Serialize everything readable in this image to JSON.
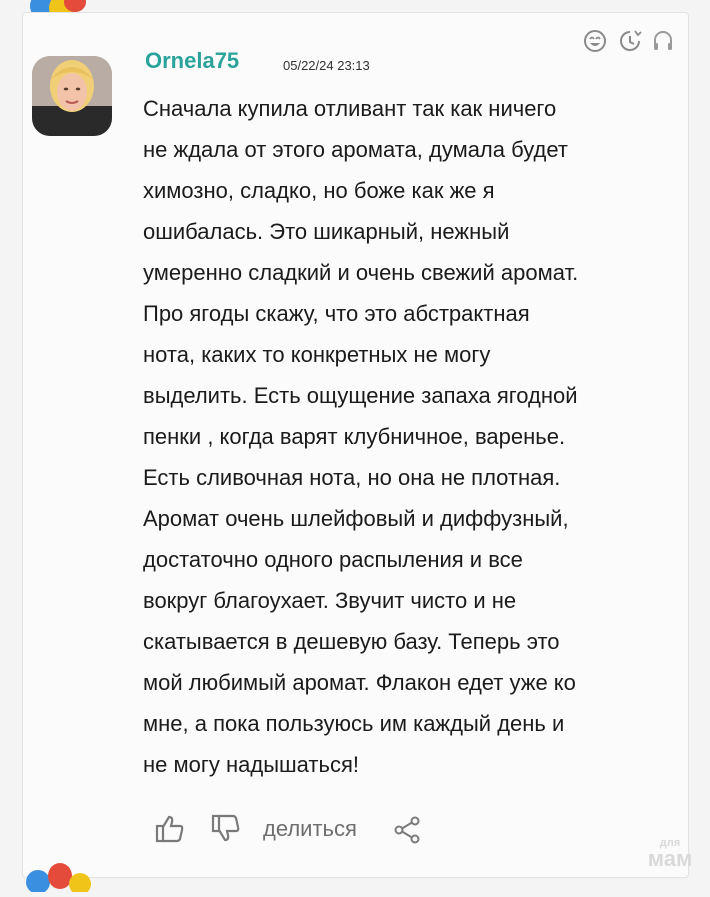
{
  "post": {
    "username": "Ornela75",
    "timestamp": "05/22/24 23:13",
    "lines": [
      "Сначала купила отливант так как ничего",
      "не ждала от этого аромата, думала будет",
      "химозно, сладко, но боже как же я",
      "ошибалась. Это шикарный, нежный",
      "умеренно сладкий и очень свежий аромат.",
      "Про ягоды скажу, что это абстрактная",
      "нота, каких то конкретных не могу",
      "выделить. Есть ощущение запаха ягодной",
      "пенки , когда варят клубничное, варенье.",
      "Есть сливочная нота, но она не плотная.",
      "Аромат очень шлейфовый и диффузный,",
      "достаточно одного распыления и все",
      "вокруг благоухает. Звучит чисто и не",
      "скатывается в дешевую базу. Теперь это",
      "мой любимый аромат. Флакон едет уже ко",
      "мне, а пока пользуюсь им каждый день и",
      "не могу надышаться!"
    ]
  },
  "actions": {
    "share_label": "делиться"
  },
  "watermark": {
    "top": "для",
    "bottom": "мам"
  },
  "icons": [
    "smiley-icon",
    "clock-icon",
    "headphones-icon",
    "like-icon",
    "dislike-icon",
    "share-icon",
    "balloon-icon"
  ],
  "colors": {
    "username": "#2aa39a",
    "text": "#1b1b1b",
    "muted": "#6e6e6e",
    "card_bg": "#fbfbfb"
  }
}
